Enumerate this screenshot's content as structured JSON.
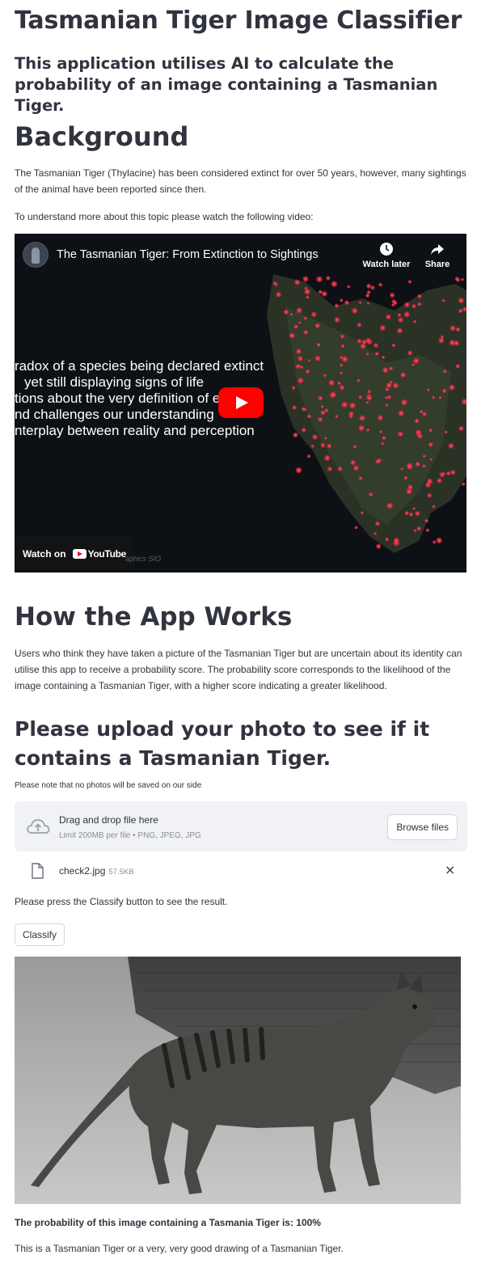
{
  "header": {
    "title": "Tasmanian Tiger Image Classifier",
    "subtitle": "This application utilises AI to calculate the probability of an image containing a Tasmanian Tiger."
  },
  "background": {
    "heading": "Background",
    "paragraph1": "The Tasmanian Tiger (Thylacine) has been considered extinct for over 50 years, however, many sightings of the animal have been reported since then.",
    "paragraph2": "To understand more about this topic please watch the following video:"
  },
  "video": {
    "title": "The Tasmanian Tiger: From Extinction to Sightings",
    "watch_later_label": "Watch later",
    "share_label": "Share",
    "overlay_lines": [
      "radox of a species being declared extinct",
      "yet still displaying signs of life",
      "tions about the very definition of e",
      "nd challenges our understanding",
      "nterplay between reality and perception"
    ],
    "watch_on_label": "Watch on",
    "youtube_label": "YouTube",
    "credit": "aphics SIO",
    "icons": {
      "play": "play-icon",
      "clock": "clock-icon",
      "share": "share-arrow-icon"
    }
  },
  "how": {
    "heading": "How the App Works",
    "paragraph": "Users who think they have taken a picture of the Tasmanian Tiger but are uncertain about its identity can utilise this app to receive a probability score. The probability score corresponds to the likelihood of the image containing a Tasmanian Tiger, with a higher score indicating a greater likelihood."
  },
  "upload": {
    "heading": "Please upload your photo to see if it contains a Tasmanian Tiger.",
    "note": "Please note that no photos will be saved on our side",
    "dropzone_title": "Drag and drop file here",
    "dropzone_limit": "Limit 200MB per file • PNG, JPEG, JPG",
    "browse_label": "Browse files",
    "file_name": "check2.jpg",
    "file_size": "57.5KB",
    "close_symbol": "×"
  },
  "classify": {
    "instruction": "Please press the Classify button to see the result.",
    "button_label": "Classify"
  },
  "result": {
    "probability_text": "The probability of this image containing a Tasmania Tiger is: 100%",
    "verdict_text": "This is a Tasmanian Tiger or a very, very good drawing of a Tasmanian Tiger."
  },
  "colors": {
    "text": "#31333f",
    "youtube_red": "#ff0000",
    "dropzone_bg": "#f0f2f6",
    "muted": "#8b8d98"
  }
}
